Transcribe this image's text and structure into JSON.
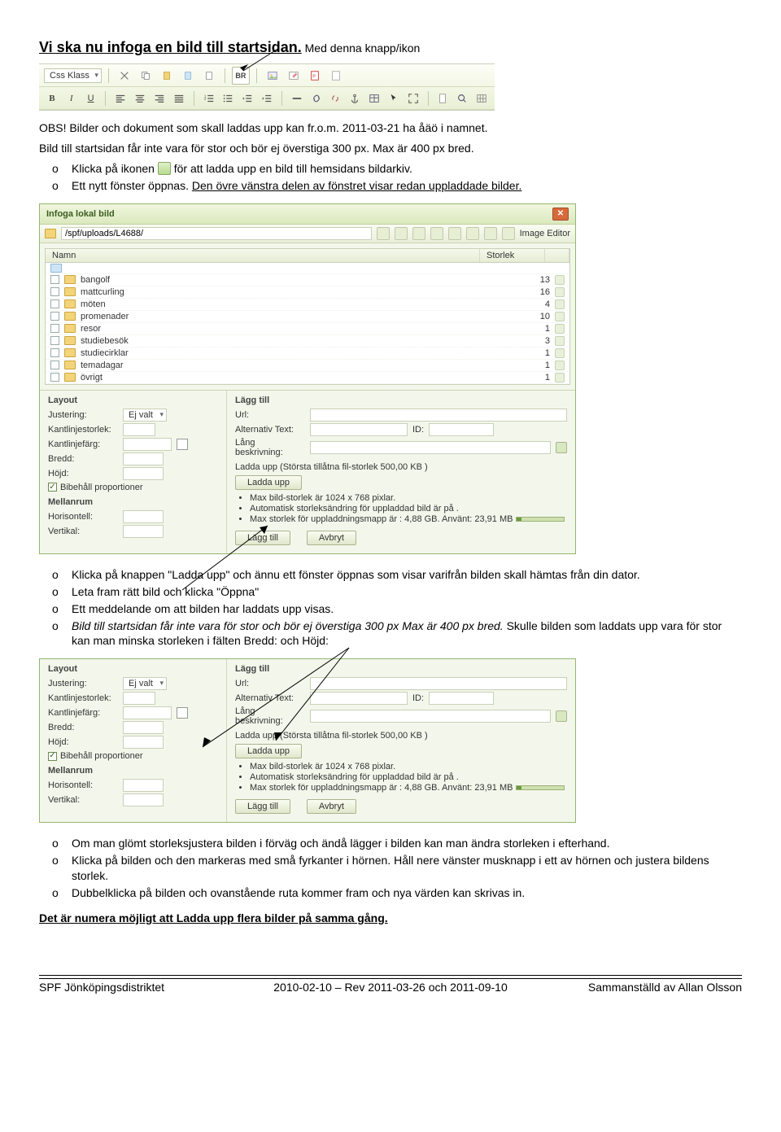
{
  "heading": "Vi ska nu infoga en bild till startsidan.",
  "heading_tail": " Med denna knapp/ikon",
  "toolbar": {
    "css_klass": "Css Klass",
    "icons_row1": [
      "BR"
    ],
    "bold": "B",
    "italic": "I",
    "underline": "U"
  },
  "intro": {
    "line1": "OBS! Bilder och dokument som skall laddas upp kan fr.o.m. 2011-03-21 ha åäö i namnet.",
    "line2": "Bild till startsidan får inte vara för stor och bör ej överstiga 300 px. Max är 400 px bred.",
    "b1a": "Klicka på ikonen",
    "b1b": "för att ladda upp en bild till hemsidans bildarkiv.",
    "b2a": "Ett nytt fönster öppnas. ",
    "b2b": "Den övre vänstra delen av fönstret visar redan uppladdade bilder."
  },
  "dialog": {
    "title": "Infoga lokal bild",
    "close": "✕",
    "path": "/spf/uploads/L4688/",
    "image_editor": "Image Editor",
    "cols": {
      "name": "Namn",
      "size": "Storlek"
    },
    "rows": [
      {
        "name": "bangolf",
        "size": "13"
      },
      {
        "name": "mattcurling",
        "size": "16"
      },
      {
        "name": "möten",
        "size": "4"
      },
      {
        "name": "promenader",
        "size": "10"
      },
      {
        "name": "resor",
        "size": "1"
      },
      {
        "name": "studiebesök",
        "size": "3"
      },
      {
        "name": "studiecirklar",
        "size": "1"
      },
      {
        "name": "temadagar",
        "size": "1"
      },
      {
        "name": "övrigt",
        "size": "1"
      }
    ],
    "left": {
      "title": "Layout",
      "justering": "Justering:",
      "justval": "Ej valt",
      "kantstorlek": "Kantlinjestorlek:",
      "kantfarg": "Kantlinjefärg:",
      "bredd": "Bredd:",
      "hojd": "Höjd:",
      "behall": "Bibehåll proportioner",
      "mellan": "Mellanrum",
      "horis": "Horisontell:",
      "vert": "Vertikal:"
    },
    "right": {
      "title": "Lägg till",
      "url": "Url:",
      "alt": "Alternativ Text:",
      "id": "ID:",
      "lang": "Lång beskrivning:",
      "ladda_caption": "Ladda upp (Största tillåtna fil-storlek 500,00 KB )",
      "ladda_btn": "Ladda upp",
      "n1": "Max bild-storlek är 1024 x 768 pixlar.",
      "n2": "Automatisk storleksändring för uppladdad bild är på .",
      "n3": "Max storlek för uppladdningsmapp är : 4,88 GB. Använt: 23,91 MB",
      "lagg": "Lägg till",
      "avbryt": "Avbryt"
    }
  },
  "mid_bullets": {
    "b1": "Klicka på knappen \"Ladda upp\" och ännu ett fönster öppnas som visar varifrån bilden skall hämtas från din dator.",
    "b2": "Leta fram rätt bild och klicka \"Öppna\"",
    "b3": "Ett meddelande om att bilden har laddats upp visas.",
    "b4a": "Bild till startsidan får inte vara för stor och bör ej överstiga 300 px Max är 400 px bred.",
    "b4b": " Skulle bilden som laddats upp vara för stor kan man minska storleken i fälten Bredd: och Höjd:"
  },
  "end_bullets": {
    "b1": "Om man glömt storleksjustera bilden i förväg och ändå lägger i bilden kan man ändra storleken i efterhand.",
    "b2": "Klicka på bilden och den markeras med små fyrkanter i hörnen. Håll nere vänster musknapp i ett av hörnen och justera bildens storlek.",
    "b3": "Dubbelklicka på bilden och ovanstående ruta kommer fram och nya värden kan skrivas in."
  },
  "final_line": "Det är numera möjligt att Ladda upp flera bilder på samma gång.",
  "footer": {
    "left": "SPF Jönköpingsdistriktet",
    "center": "2010-02-10 – Rev 2011-03-26 och 2011-09-10",
    "right": "Sammanställd av Allan Olsson"
  }
}
